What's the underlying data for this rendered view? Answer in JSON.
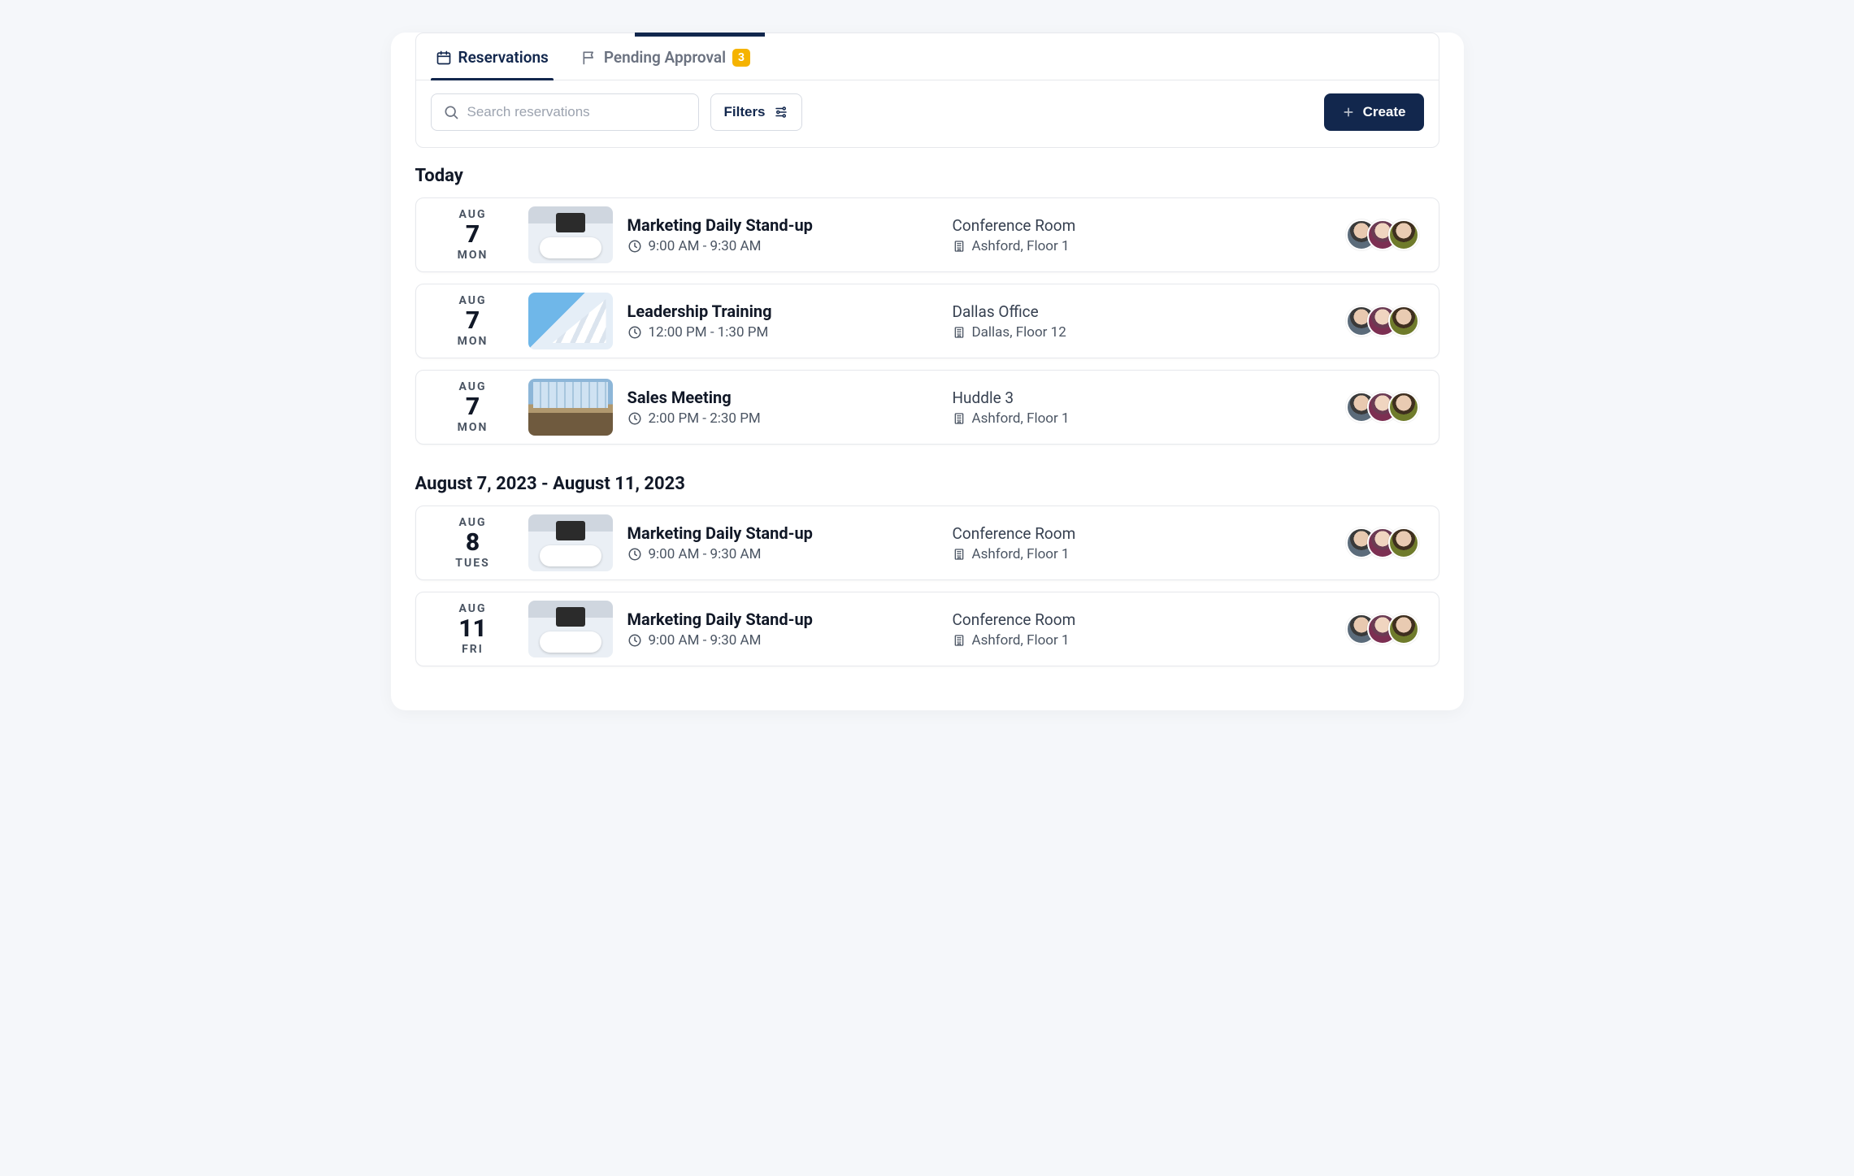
{
  "tabs": {
    "reservations": "Reservations",
    "pending": "Pending Approval",
    "pending_count": "3"
  },
  "toolbar": {
    "search_placeholder": "Search reservations",
    "filters_label": "Filters",
    "create_label": "Create"
  },
  "sections": [
    {
      "title": "Today",
      "items": [
        {
          "month": "AUG",
          "day": "7",
          "wday": "MON",
          "thumb": "conf",
          "title": "Marketing Daily Stand-up",
          "time": "9:00 AM - 9:30 AM",
          "room": "Conference Room",
          "loc": "Ashford, Floor 1"
        },
        {
          "month": "AUG",
          "day": "7",
          "wday": "MON",
          "thumb": "office1",
          "title": "Leadership Training",
          "time": "12:00 PM - 1:30 PM",
          "room": "Dallas Office",
          "loc": "Dallas, Floor 12"
        },
        {
          "month": "AUG",
          "day": "7",
          "wday": "MON",
          "thumb": "office2",
          "title": "Sales Meeting",
          "time": "2:00 PM - 2:30 PM",
          "room": "Huddle 3",
          "loc": "Ashford, Floor 1"
        }
      ]
    },
    {
      "title": "August 7, 2023 - August 11, 2023",
      "items": [
        {
          "month": "AUG",
          "day": "8",
          "wday": "TUES",
          "thumb": "conf",
          "title": "Marketing Daily Stand-up",
          "time": "9:00 AM - 9:30 AM",
          "room": "Conference Room",
          "loc": "Ashford, Floor 1"
        },
        {
          "month": "AUG",
          "day": "11",
          "wday": "FRI",
          "thumb": "conf",
          "title": "Marketing Daily Stand-up",
          "time": "9:00 AM - 9:30 AM",
          "room": "Conference Room",
          "loc": "Ashford, Floor 1"
        }
      ]
    }
  ]
}
